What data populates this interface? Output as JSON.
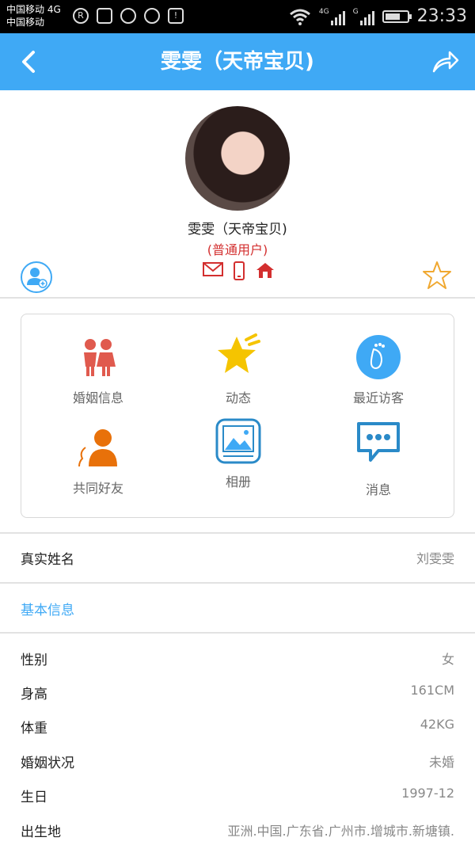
{
  "status_bar": {
    "carrier_line1": "中国移动 4G",
    "carrier_line2": "中国移动",
    "net_badge_1": "4G",
    "net_badge_2": "G",
    "time": "23:33"
  },
  "header": {
    "title": "雯雯（天帝宝贝)"
  },
  "profile": {
    "name": "雯雯（天帝宝贝)",
    "user_type": "(普通用户)"
  },
  "grid": {
    "items": [
      {
        "label": "婚姻信息",
        "icon": "couple-icon"
      },
      {
        "label": "动态",
        "icon": "star-burst-icon"
      },
      {
        "label": "最近访客",
        "icon": "footprint-icon"
      },
      {
        "label": "共同好友",
        "icon": "friends-icon"
      },
      {
        "label": "相册",
        "icon": "photo-album-icon"
      },
      {
        "label": "消息",
        "icon": "chat-bubble-icon"
      }
    ]
  },
  "real_name": {
    "label": "真实姓名",
    "value": "刘雯雯"
  },
  "basic_info": {
    "title": "基本信息",
    "rows": [
      {
        "label": "性别",
        "value": "女"
      },
      {
        "label": "身高",
        "value": "161CM"
      },
      {
        "label": "体重",
        "value": "42KG"
      },
      {
        "label": "婚姻状况",
        "value": "未婚"
      },
      {
        "label": "生日",
        "value": "1997-12"
      },
      {
        "label": "出生地",
        "value": "亚洲.中国.广东省.广州市.增城市.新塘镇."
      }
    ]
  },
  "colors": {
    "accent": "#3fa9f5",
    "red": "#d32f2f",
    "orange": "#e8710a",
    "yellow": "#f5c400"
  }
}
